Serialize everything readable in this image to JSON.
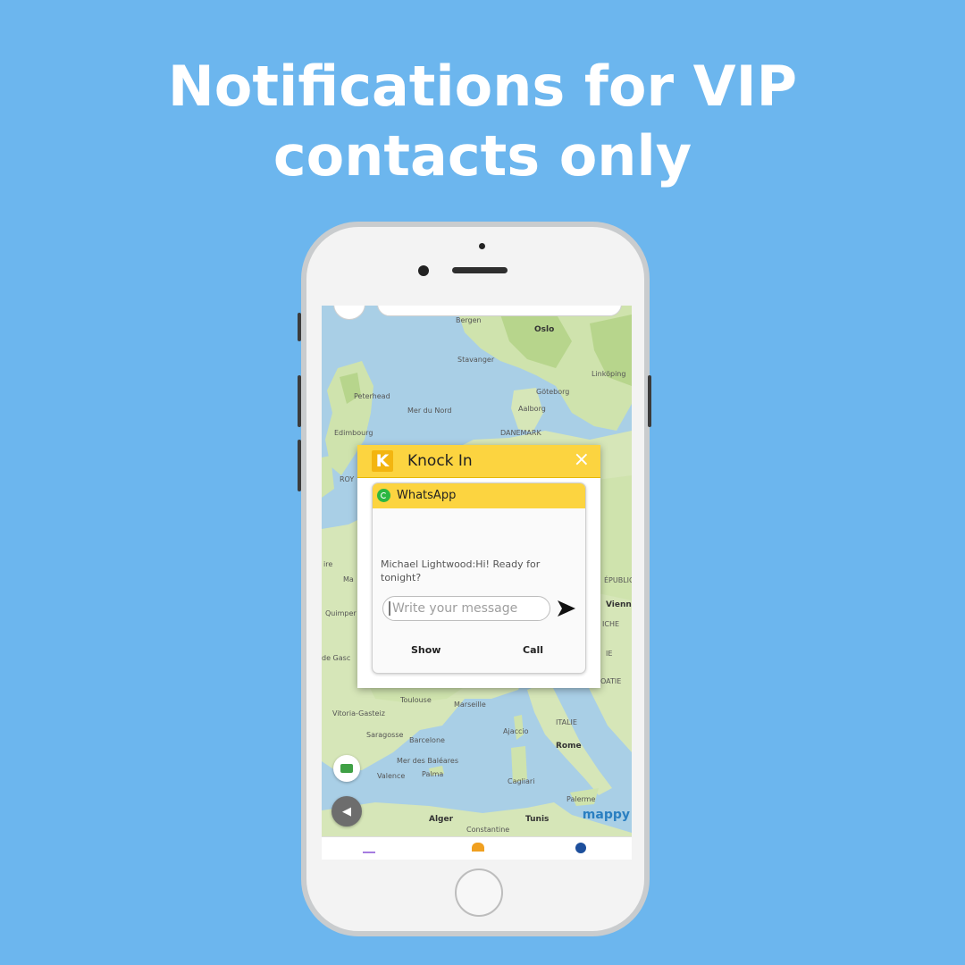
{
  "headline": {
    "line1": "Notifications for VIP",
    "line2": "contacts only"
  },
  "map": {
    "labels": {
      "bergen": "Bergen",
      "oslo": "Oslo",
      "stavanger": "Stavanger",
      "linkoping": "Linköping",
      "goteborg": "Göteborg",
      "aalborg": "Aalborg",
      "peterhead": "Peterhead",
      "mer_du_nord": "Mer du Nord",
      "danemark": "DANEMARK",
      "edimbourg": "Edimbourg",
      "roy": "ROY",
      "quimper": "Quimper",
      "de_gasc": "de Gasc",
      "toulouse": "Toulouse",
      "marseille": "Marseille",
      "vitoria_gasteiz": "Vitoria-Gasteiz",
      "saragosse": "Saragosse",
      "barcelone": "Barcelone",
      "ajaccio": "Ajaccio",
      "rome": "Rome",
      "italie": "ITALIE",
      "mer_des_baleares": "Mer des Baléares",
      "palma": "Palma",
      "valence": "Valence",
      "cagliari": "Cagliari",
      "palerme": "Palerme",
      "alger": "Alger",
      "tunis": "Tunis",
      "constantine": "Constantine",
      "vienne": "Vienne",
      "republique": "ÉPUBLIQUE",
      "iche": "ICHE",
      "oatie": "OATIE",
      "ie": "IE",
      "ire": "ire",
      "ma": "Ma"
    },
    "brand": "mappy",
    "colors": {
      "sea": "#a9cfe6",
      "land": "#d6e6b8",
      "forest": "#b9d890"
    }
  },
  "popup": {
    "app_title": "Knock In",
    "logo_letter": "K",
    "close_symbol": "×",
    "notification": {
      "app_name": "WhatsApp",
      "message": "Michael Lightwood:Hi! Ready for tonight?",
      "input_placeholder": "Write your message",
      "send_symbol": "➤",
      "actions": {
        "show": "Show",
        "call": "Call"
      }
    },
    "colors": {
      "header": "#fcd440",
      "logo": "#f3b510",
      "whatsapp": "#2cb742"
    }
  },
  "icons": {
    "close": "close-icon",
    "send": "send-icon",
    "whatsapp": "whatsapp-icon",
    "navigate": "navigation-arrow-icon",
    "layers": "map-layers-icon"
  },
  "colors": {
    "background": "#6cb6ee",
    "headline": "#ffffff"
  }
}
